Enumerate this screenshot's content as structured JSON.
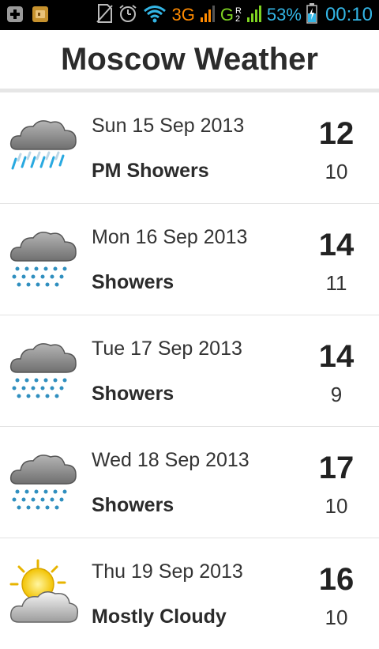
{
  "status_bar": {
    "network": "3G",
    "carrier_letter": "G",
    "roaming_tag": "R",
    "sim_index": "2",
    "battery_percent": "53%",
    "time": "00:10",
    "icons": [
      "add-icon",
      "app-notification-icon",
      "no-sim-icon",
      "alarm-icon",
      "wifi-icon",
      "signal-icon",
      "signal-icon",
      "battery-charging-icon"
    ]
  },
  "header": {
    "title": "Moscow Weather"
  },
  "forecast": [
    {
      "date": "Sun 15 Sep 2013",
      "condition": "PM Showers",
      "high": "12",
      "low": "10",
      "icon": "pm-showers-icon"
    },
    {
      "date": "Mon 16 Sep 2013",
      "condition": "Showers",
      "high": "14",
      "low": "11",
      "icon": "showers-icon"
    },
    {
      "date": "Tue 17 Sep 2013",
      "condition": "Showers",
      "high": "14",
      "low": "9",
      "icon": "showers-icon"
    },
    {
      "date": "Wed 18 Sep 2013",
      "condition": "Showers",
      "high": "17",
      "low": "10",
      "icon": "showers-icon"
    },
    {
      "date": "Thu 19 Sep 2013",
      "condition": "Mostly Cloudy",
      "high": "16",
      "low": "10",
      "icon": "mostly-cloudy-icon"
    }
  ]
}
